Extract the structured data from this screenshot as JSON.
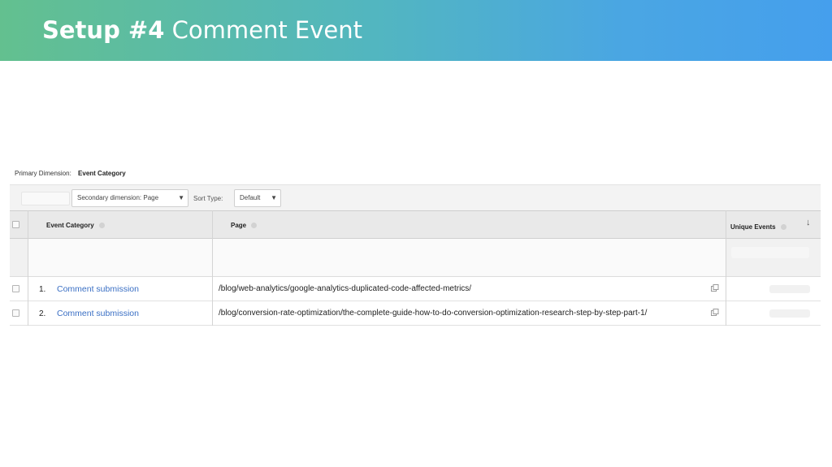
{
  "banner": {
    "title_bold": "Setup #4",
    "title_rest": "Comment Event"
  },
  "report": {
    "primary_dimension_label": "Primary Dimension:",
    "primary_dimension_value": "Event Category",
    "toolbar": {
      "secondary_dimension": "Secondary dimension: Page",
      "sort_type_label": "Sort Type:",
      "sort_type_value": "Default"
    },
    "columns": {
      "event_category": "Event Category",
      "page": "Page",
      "unique_events": "Unique Events"
    },
    "rows": [
      {
        "index": "1.",
        "event_category": "Comment submission",
        "page": "/blog/web-analytics/google-analytics-duplicated-code-affected-metrics/"
      },
      {
        "index": "2.",
        "event_category": "Comment submission",
        "page": "/blog/conversion-rate-optimization/the-complete-guide-how-to-do-conversion-optimization-research-step-by-step-part-1/"
      }
    ]
  },
  "icons": {
    "caret": "caret-down-icon",
    "sort": "arrow-down-icon",
    "copy": "copy-icon"
  },
  "colors": {
    "banner_start": "#63c08f",
    "banner_end": "#459fed",
    "link": "#3a6fc4"
  }
}
